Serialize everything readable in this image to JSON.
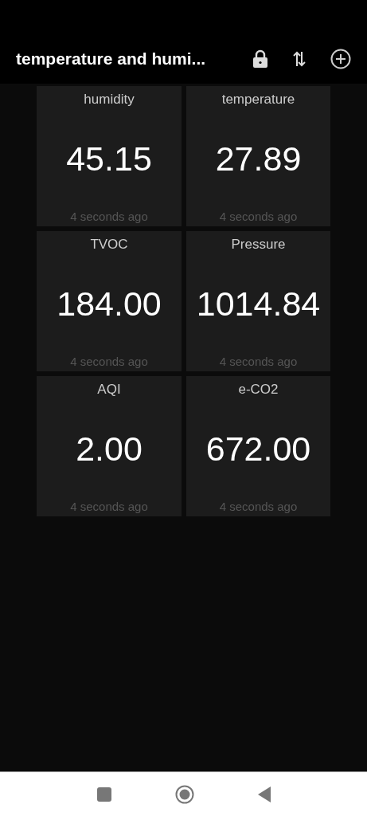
{
  "app_bar": {
    "title": "temperature and humi..."
  },
  "tiles": [
    {
      "label": "humidity",
      "value": "45.15",
      "updated": "4 seconds ago"
    },
    {
      "label": "temperature",
      "value": "27.89",
      "updated": "4 seconds ago"
    },
    {
      "label": "TVOC",
      "value": "184.00",
      "updated": "4 seconds ago"
    },
    {
      "label": "Pressure",
      "value": "1014.84",
      "updated": "4 seconds ago"
    },
    {
      "label": "AQI",
      "value": "2.00",
      "updated": "4 seconds ago"
    },
    {
      "label": "e-CO2",
      "value": "672.00",
      "updated": "4 seconds ago"
    }
  ]
}
